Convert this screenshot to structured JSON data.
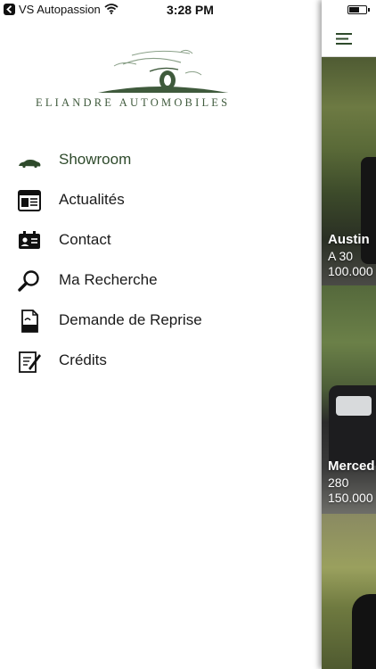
{
  "status_bar": {
    "carrier": "VS Autopassion",
    "time": "3:28 PM"
  },
  "brand": {
    "name": "ELIANDRE AUTOMOBILES",
    "accent_color": "#3f5a3c"
  },
  "menu": {
    "items": [
      {
        "label": "Showroom",
        "icon": "car-icon",
        "active": true
      },
      {
        "label": "Actualités",
        "icon": "newspaper-icon",
        "active": false
      },
      {
        "label": "Contact",
        "icon": "contact-card-icon",
        "active": false
      },
      {
        "label": "Ma Recherche",
        "icon": "search-icon",
        "active": false
      },
      {
        "label": "Demande de Reprise",
        "icon": "document-icon",
        "active": false
      },
      {
        "label": "Crédits",
        "icon": "edit-icon",
        "active": false
      }
    ]
  },
  "listing": {
    "cars": [
      {
        "name": "Austin",
        "model": "A 30",
        "price": "100.000"
      },
      {
        "name": "Merced",
        "model": "280",
        "price": "150.000"
      }
    ]
  }
}
